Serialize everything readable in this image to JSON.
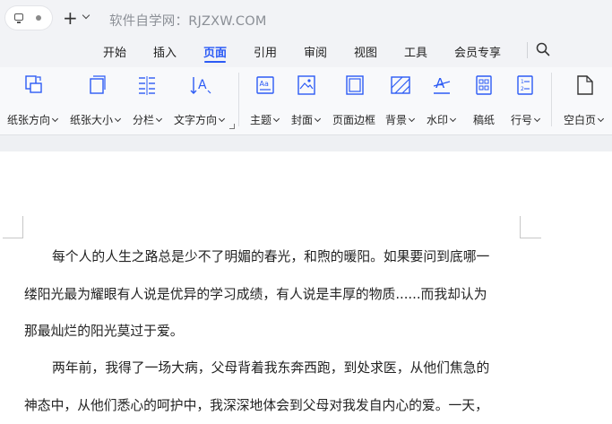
{
  "titlebar": {
    "site_text": "软件自学网：RJZXW.COM",
    "new_tab_symbol": "+"
  },
  "menu": {
    "tabs": [
      {
        "label": "开始"
      },
      {
        "label": "插入"
      },
      {
        "label": "页面",
        "active": true
      },
      {
        "label": "引用"
      },
      {
        "label": "审阅"
      },
      {
        "label": "视图"
      },
      {
        "label": "工具"
      },
      {
        "label": "会员专享"
      }
    ],
    "active_color": "#2c5bf5"
  },
  "ribbon": {
    "items": [
      {
        "label": "纸张方向",
        "icon": "paper-orientation-icon",
        "dropdown": true
      },
      {
        "label": "纸张大小",
        "icon": "paper-size-icon",
        "dropdown": true
      },
      {
        "label": "分栏",
        "icon": "columns-icon",
        "dropdown": true
      },
      {
        "label": "文字方向",
        "icon": "text-direction-icon",
        "dropdown": true
      },
      {
        "label": "主题",
        "icon": "theme-icon",
        "dropdown": true
      },
      {
        "label": "封面",
        "icon": "cover-icon",
        "dropdown": true
      },
      {
        "label": "页面边框",
        "icon": "page-border-icon",
        "dropdown": false
      },
      {
        "label": "背景",
        "icon": "background-icon",
        "dropdown": true
      },
      {
        "label": "水印",
        "icon": "watermark-icon",
        "dropdown": true
      },
      {
        "label": "稿纸",
        "icon": "manuscript-paper-icon",
        "dropdown": false
      },
      {
        "label": "行号",
        "icon": "line-number-icon",
        "dropdown": true
      },
      {
        "label": "空白页",
        "icon": "blank-page-icon",
        "dropdown": true
      }
    ]
  },
  "document": {
    "paragraphs": [
      {
        "lines": [
          "每个人的人生之路总是少不了明媚的春光，和煦的暖阳。如果要问到底哪一",
          "缕阳光最为耀眼有人说是优异的学习成绩，有人说是丰厚的物质......而我却认为",
          "那最灿烂的阳光莫过于爱。"
        ]
      },
      {
        "lines": [
          "两年前，我得了一场大病，父母背着我东奔西跑，到处求医，从他们焦急的",
          "神态中，从他们悉心的呵护中，我深深地体会到父母对我发自内心的爱。一天，"
        ]
      }
    ]
  }
}
